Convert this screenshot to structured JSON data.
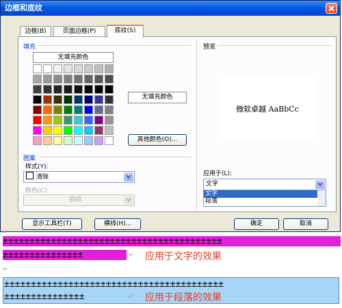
{
  "dialog": {
    "title": "边框和底纹",
    "tabs": [
      {
        "label": "边框(B)",
        "active": false
      },
      {
        "label": "页面边框(P)",
        "active": false
      },
      {
        "label": "底纹(S)",
        "active": true
      }
    ],
    "fill": {
      "group_label": "填充",
      "no_fill_header": "无填充颜色",
      "selected_fill_label": "无填充颜色",
      "more_colors_button": "其他颜色(O)...",
      "palette": [
        [
          "#ffffff",
          "#ffffff",
          "#f2f2f2",
          "#e4e4e4",
          "#d8d8d8",
          "#cccccc",
          "#bfbfbf",
          "#b2b2b2"
        ],
        [
          "#a6a6a6",
          "#999999",
          "#8c8c8c",
          "#808080",
          "#737373",
          "#666666",
          "#595959",
          "#4d4d4d"
        ],
        [
          "#404040",
          "#333333",
          "#262626",
          "#1a1a1a",
          "#111111",
          "#0a0a0a",
          "#050505",
          "#000000"
        ],
        [
          "#000000",
          "#993300",
          "#333300",
          "#003300",
          "#003366",
          "#000080",
          "#333399",
          "#333333"
        ],
        [
          "#800000",
          "#ff6600",
          "#808000",
          "#008000",
          "#008080",
          "#0000ff",
          "#666699",
          "#808080"
        ],
        [
          "#ff0000",
          "#ff9900",
          "#99cc00",
          "#339966",
          "#33cccc",
          "#3366ff",
          "#800080",
          "#969696"
        ],
        [
          "#ff00ff",
          "#ffcc00",
          "#ffff00",
          "#00ff00",
          "#00ffff",
          "#00ccff",
          "#993366",
          "#c0c0c0"
        ],
        [
          "#ff99cc",
          "#ffcc99",
          "#ffff99",
          "#ccffcc",
          "#ccffff",
          "#99ccff",
          "#cc99ff",
          "#ffffff"
        ]
      ]
    },
    "pattern": {
      "group_label": "图案",
      "style_label": "样式(Y):",
      "style_value": "清除",
      "color_label": "颜色(C):",
      "color_value": "自动"
    },
    "preview": {
      "group_label": "预览",
      "sample_text": "微软卓越 AaBbCc"
    },
    "apply_to": {
      "label": "应用于(L):",
      "value": "文字",
      "options": [
        {
          "label": "文字",
          "selected": true
        },
        {
          "label": "段落",
          "selected": false
        }
      ]
    },
    "buttons": {
      "toolbar": "显示工具栏(T)",
      "hline": "横线(H)...",
      "ok": "确定",
      "cancel": "取消"
    }
  },
  "document": {
    "para_mark": "↵",
    "text_example": {
      "line1": "±±±±±±±±±±±±±±±±±±±±±±±±±±±±±±±±±±±±±±±±±",
      "line2": "±±±±±±±±±±±±±±±",
      "caption": "应用于文字的效果",
      "highlight_color": "#e320d9"
    },
    "para_example": {
      "line1": "±±±±±±±±±±±±±±±±±±±±±±±±±±±±±±±±±±±±±±±±±",
      "line2": "±±±±±±±±±±±±±±±",
      "caption": "应用于段落的效果",
      "band_color": "#a8d4f5"
    },
    "caption_color": "#e63b24"
  }
}
